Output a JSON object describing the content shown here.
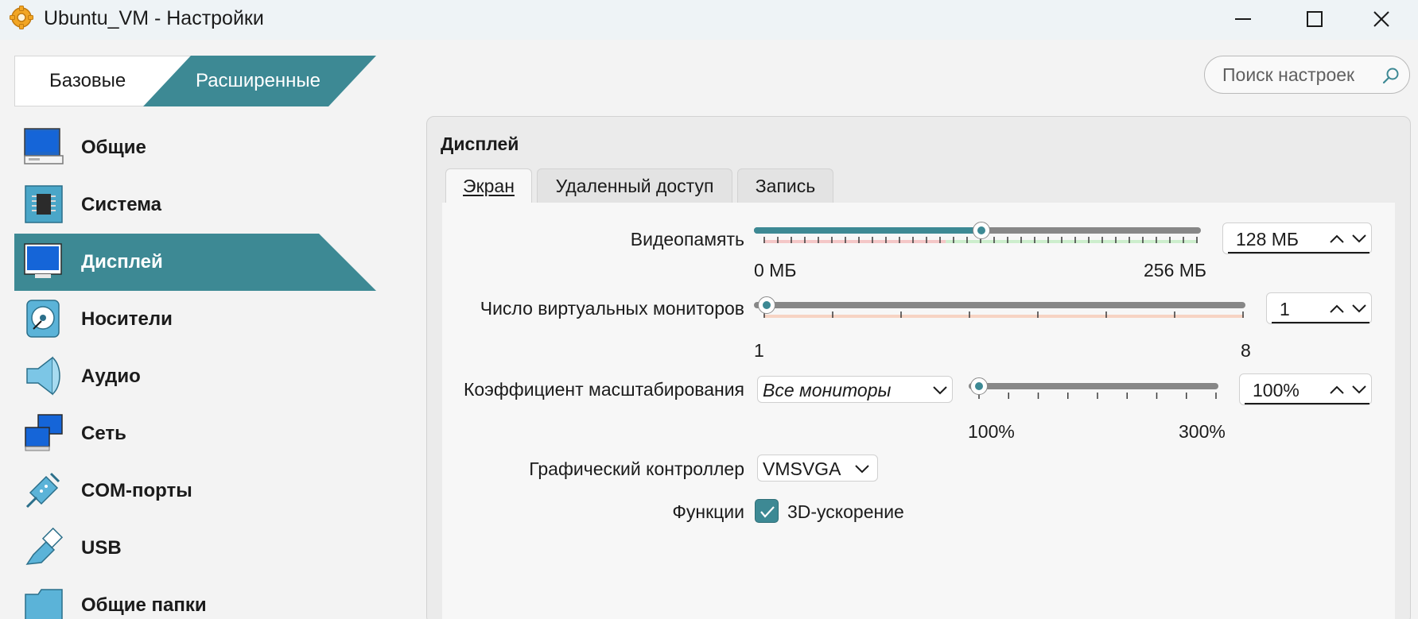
{
  "window": {
    "title": "Ubuntu_VM - Настройки",
    "controls": [
      "minimize-icon",
      "maximize-icon",
      "close-icon"
    ]
  },
  "mode_tabs": {
    "basic": "Базовые",
    "advanced": "Расширенные",
    "active": "advanced"
  },
  "search": {
    "placeholder": "Поиск настроек",
    "icon": "search-icon"
  },
  "sidebar": {
    "items": [
      {
        "label": "Общие",
        "icon": "general-monitor-icon"
      },
      {
        "label": "Система",
        "icon": "chip-icon"
      },
      {
        "label": "Дисплей",
        "icon": "display-icon",
        "active": true
      },
      {
        "label": "Носители",
        "icon": "disk-icon"
      },
      {
        "label": "Аудио",
        "icon": "speaker-icon"
      },
      {
        "label": "Сеть",
        "icon": "network-icon"
      },
      {
        "label": "COM-порты",
        "icon": "serial-port-icon"
      },
      {
        "label": "USB",
        "icon": "usb-icon"
      },
      {
        "label": "Общие папки",
        "icon": "folder-icon"
      }
    ]
  },
  "panel": {
    "title": "Дисплей",
    "tabs": [
      {
        "label": "Экран",
        "active": true
      },
      {
        "label": "Удаленный доступ"
      },
      {
        "label": "Запись"
      }
    ]
  },
  "screen": {
    "video_memory": {
      "label": "Видеопамять",
      "value": "128 МБ",
      "min_label": "0 МБ",
      "max_label": "256 МБ",
      "fraction": 0.5
    },
    "monitors": {
      "label": "Число виртуальных мониторов",
      "value": "1",
      "min_label": "1",
      "max_label": "8",
      "fraction": 0.0
    },
    "scale": {
      "label": "Коэффициент масштабирования",
      "monitor_select": "Все мониторы",
      "value": "100%",
      "min_label": "100%",
      "max_label": "300%",
      "fraction": 0.0
    },
    "controller": {
      "label": "Графический контроллер",
      "value": "VMSVGA"
    },
    "features": {
      "label": "Функции",
      "accel_3d_label": "3D-ускорение",
      "accel_3d_checked": true
    }
  },
  "colors": {
    "accent": "#3d8994",
    "track": "#878787",
    "tick_red": "#f4c7c7",
    "tick_green": "#cdeecd",
    "tick_peach": "#f7d4c4"
  }
}
